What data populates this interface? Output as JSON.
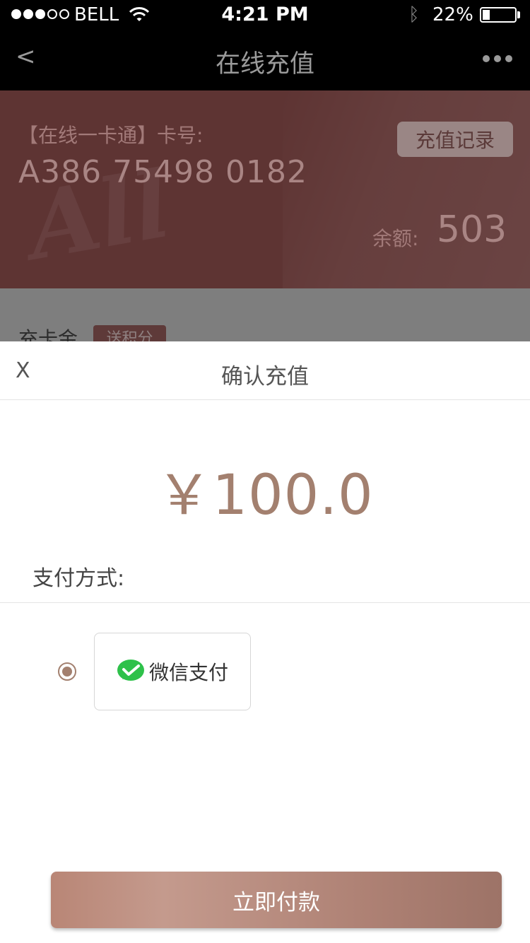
{
  "status_bar": {
    "carrier": "BELL",
    "time": "4:21 PM",
    "battery": "22%",
    "battery_level": 0.22
  },
  "nav": {
    "back": "<",
    "title": "在线充值"
  },
  "card": {
    "label": "【在线一卡通】卡号:",
    "number": "A386 75498 0182",
    "history_button": "充值记录",
    "balance_label": "余额:",
    "balance_value": "503",
    "watermark": "All"
  },
  "background_section": {
    "label": "充卡金",
    "badge": "送积分"
  },
  "sheet": {
    "close": "X",
    "title": "确认充值",
    "amount": "￥100.0",
    "pay_method_label": "支付方式:",
    "pay_option_label": "微信支付",
    "pay_button": "立即付款"
  },
  "colors": {
    "accent": "#a3806f",
    "card_bg": "#5e3433",
    "wechat_green": "#2ec14a"
  },
  "icons": {
    "wifi": "wifi-icon",
    "bluetooth": "bluetooth-icon",
    "battery": "battery-icon",
    "more": "more-icon",
    "wechat": "wechat-pay-icon"
  }
}
